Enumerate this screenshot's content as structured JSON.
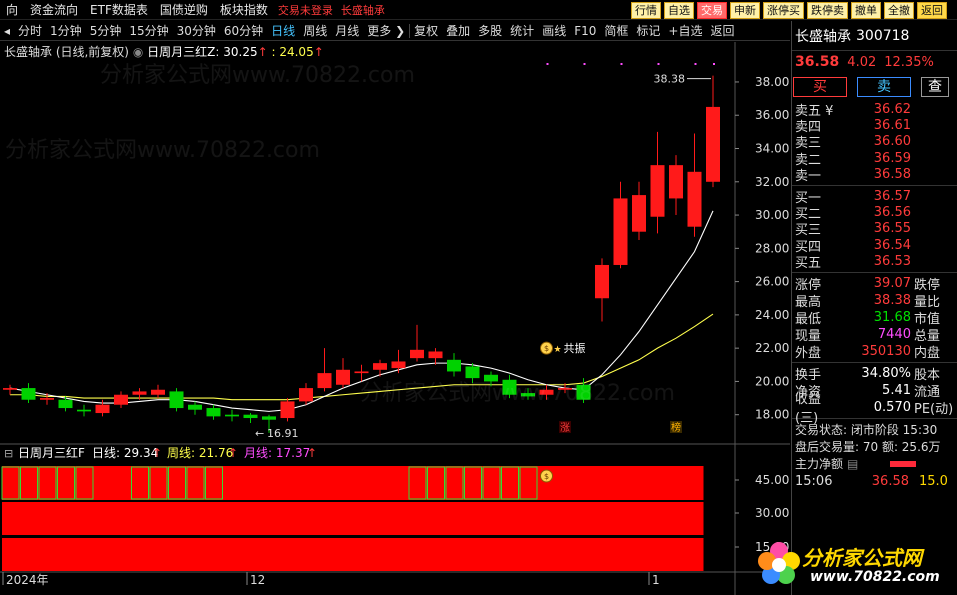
{
  "top_nav": [
    "向",
    "资金流向",
    "ETF数据表",
    "国债逆购",
    "板块指数"
  ],
  "top_status": "交易未登录",
  "top_stock": "长盛轴承",
  "top_buttons": [
    "行情",
    "自选",
    "交易",
    "申新",
    "涨停买",
    "跌停卖",
    "撤单",
    "全撤",
    "返回"
  ],
  "periods": [
    "分时",
    "1分钟",
    "5分钟",
    "15分钟",
    "30分钟",
    "60分钟",
    "日线",
    "周线",
    "月线",
    "更多"
  ],
  "active_period": "日线",
  "tools": [
    "复权",
    "叠加",
    "多股",
    "统计",
    "画线",
    "F10",
    "简框",
    "标记",
    "+自选",
    "返回"
  ],
  "chart_header": {
    "title": "长盛轴承 (日线,前复权)",
    "indicator": "日周月三红Z",
    "value1": "30.25",
    "value2": "24.05"
  },
  "sub_header": {
    "indicator": "日周月三红F",
    "day": "日线: 29.34",
    "week": "周线: 21.76",
    "month": "月线: 17.37"
  },
  "annotations": {
    "high_label": "38.38",
    "low_label": "16.91",
    "resonance_label": "共振",
    "zhang_badge": "涨",
    "bang_badge": "榜"
  },
  "x_axis_labels": [
    "2024年",
    "12",
    "1"
  ],
  "quote": {
    "name": "长盛轴承",
    "code": "300718",
    "price": "36.58",
    "change": "4.02",
    "pct": "12.35%",
    "buy_label": "买",
    "sell_label": "卖",
    "query_label": "查",
    "asks": [
      {
        "label": "卖五 ¥",
        "price": "36.62"
      },
      {
        "label": "卖四",
        "price": "36.61"
      },
      {
        "label": "卖三",
        "price": "36.60"
      },
      {
        "label": "卖二",
        "price": "36.59"
      },
      {
        "label": "卖一",
        "price": "36.58"
      }
    ],
    "bids": [
      {
        "label": "买一",
        "price": "36.57"
      },
      {
        "label": "买二",
        "price": "36.56"
      },
      {
        "label": "买三",
        "price": "36.55"
      },
      {
        "label": "买四",
        "price": "36.54"
      },
      {
        "label": "买五",
        "price": "36.53"
      }
    ],
    "stats1": [
      {
        "label": "涨停",
        "value": "39.07",
        "label2": "跌停",
        "color": "red"
      },
      {
        "label": "最高",
        "value": "38.38",
        "label2": "量比",
        "color": "red"
      },
      {
        "label": "最低",
        "value": "31.68",
        "label2": "市值",
        "color": "green"
      },
      {
        "label": "现量",
        "value": "7440",
        "label2": "总量",
        "color": "magenta"
      },
      {
        "label": "外盘",
        "value": "350130",
        "label2": "内盘",
        "color": "red"
      }
    ],
    "stats2": [
      {
        "label": "换手",
        "value": "34.80%",
        "label2": "股本",
        "color": "white"
      },
      {
        "label": "净资",
        "value": "5.41",
        "label2": "流通",
        "color": "white"
      },
      {
        "label": "收益(三)",
        "value": "0.570",
        "label2": "PE(动)",
        "color": "white"
      }
    ],
    "trade_status": "交易状态: 闭市阶段 15:30",
    "after_hours": "盘后交易量: 70  额: 25.6万",
    "main_flow_label": "主力净额",
    "ticks": [
      {
        "time": "15:06",
        "price": "36.58",
        "vol": "15.0"
      }
    ]
  },
  "logo": {
    "brand": "分析家公式网",
    "url": "www.70822.com"
  },
  "watermark": "分析家公式网www.70822.com",
  "chart_data": {
    "type": "candlestick",
    "title": "长盛轴承 (日线,前复权)",
    "y_ticks": [
      18.0,
      20.0,
      22.0,
      24.0,
      26.0,
      28.0,
      30.0,
      32.0,
      34.0,
      36.0,
      38.0
    ],
    "ylim": [
      16.6,
      39.2
    ],
    "candles": [
      {
        "o": 19.5,
        "c": 19.6,
        "h": 19.8,
        "l": 19.2
      },
      {
        "o": 19.6,
        "c": 18.9,
        "h": 19.9,
        "l": 18.7
      },
      {
        "o": 18.9,
        "c": 19.0,
        "h": 19.3,
        "l": 18.6
      },
      {
        "o": 18.9,
        "c": 18.4,
        "h": 19.1,
        "l": 18.2
      },
      {
        "o": 18.3,
        "c": 18.2,
        "h": 18.6,
        "l": 17.9
      },
      {
        "o": 18.1,
        "c": 18.6,
        "h": 18.9,
        "l": 17.9
      },
      {
        "o": 18.6,
        "c": 19.2,
        "h": 19.4,
        "l": 18.4
      },
      {
        "o": 19.2,
        "c": 19.4,
        "h": 19.6,
        "l": 18.9
      },
      {
        "o": 19.2,
        "c": 19.5,
        "h": 19.8,
        "l": 19.0
      },
      {
        "o": 19.4,
        "c": 18.4,
        "h": 19.6,
        "l": 18.2
      },
      {
        "o": 18.6,
        "c": 18.3,
        "h": 18.8,
        "l": 18.0
      },
      {
        "o": 18.4,
        "c": 17.9,
        "h": 18.6,
        "l": 17.7
      },
      {
        "o": 18.0,
        "c": 17.9,
        "h": 18.3,
        "l": 17.6
      },
      {
        "o": 18.0,
        "c": 17.8,
        "h": 18.1,
        "l": 17.5
      },
      {
        "o": 17.9,
        "c": 17.7,
        "h": 18.0,
        "l": 16.91
      },
      {
        "o": 17.8,
        "c": 18.8,
        "h": 19.0,
        "l": 17.6
      },
      {
        "o": 18.8,
        "c": 19.6,
        "h": 19.9,
        "l": 18.6
      },
      {
        "o": 19.6,
        "c": 20.5,
        "h": 22.0,
        "l": 19.4
      },
      {
        "o": 19.8,
        "c": 20.7,
        "h": 21.4,
        "l": 19.6
      },
      {
        "o": 20.5,
        "c": 20.6,
        "h": 21.0,
        "l": 20.0
      },
      {
        "o": 20.7,
        "c": 21.1,
        "h": 21.3,
        "l": 20.3
      },
      {
        "o": 20.8,
        "c": 21.2,
        "h": 21.9,
        "l": 20.5
      },
      {
        "o": 21.4,
        "c": 21.9,
        "h": 23.4,
        "l": 21.2
      },
      {
        "o": 21.4,
        "c": 21.8,
        "h": 22.0,
        "l": 21.0
      },
      {
        "o": 21.3,
        "c": 20.6,
        "h": 21.7,
        "l": 20.3
      },
      {
        "o": 20.9,
        "c": 20.2,
        "h": 21.1,
        "l": 19.9
      },
      {
        "o": 20.4,
        "c": 20.0,
        "h": 20.6,
        "l": 19.7
      },
      {
        "o": 20.1,
        "c": 19.2,
        "h": 20.4,
        "l": 19.0
      },
      {
        "o": 19.3,
        "c": 19.1,
        "h": 19.6,
        "l": 18.9
      },
      {
        "o": 19.2,
        "c": 19.5,
        "h": 19.8,
        "l": 18.9
      },
      {
        "o": 19.5,
        "c": 19.6,
        "h": 19.9,
        "l": 19.3
      },
      {
        "o": 19.8,
        "c": 18.9,
        "h": 20.2,
        "l": 18.7
      },
      {
        "o": 25.0,
        "c": 27.0,
        "h": 27.4,
        "l": 23.6
      },
      {
        "o": 27.0,
        "c": 31.0,
        "h": 32.0,
        "l": 26.8
      },
      {
        "o": 29.0,
        "c": 31.2,
        "h": 32.0,
        "l": 28.5
      },
      {
        "o": 29.9,
        "c": 33.0,
        "h": 35.0,
        "l": 28.9
      },
      {
        "o": 31.0,
        "c": 33.0,
        "h": 33.6,
        "l": 30.0
      },
      {
        "o": 29.3,
        "c": 32.6,
        "h": 34.9,
        "l": 28.7
      },
      {
        "o": 32.0,
        "c": 36.5,
        "h": 38.38,
        "l": 31.68
      }
    ],
    "ma_fast": [
      19.6,
      19.4,
      19.2,
      19.0,
      18.8,
      18.7,
      18.7,
      18.8,
      18.9,
      18.9,
      18.8,
      18.6,
      18.4,
      18.3,
      18.2,
      18.3,
      18.6,
      19.1,
      19.6,
      20.0,
      20.4,
      20.7,
      21.0,
      21.1,
      21.1,
      21.0,
      20.8,
      20.5,
      20.1,
      19.8,
      19.6,
      19.5,
      20.4,
      21.6,
      23.0,
      24.6,
      26.2,
      27.8,
      30.25
    ],
    "ma_slow": [
      19.2,
      19.2,
      19.1,
      19.1,
      19.0,
      19.0,
      19.0,
      19.0,
      19.0,
      19.0,
      19.0,
      19.0,
      18.9,
      18.9,
      18.9,
      18.9,
      19.0,
      19.1,
      19.2,
      19.3,
      19.4,
      19.5,
      19.6,
      19.7,
      19.8,
      19.8,
      19.8,
      19.8,
      19.8,
      19.8,
      19.8,
      19.9,
      20.3,
      20.8,
      21.3,
      22.0,
      22.6,
      23.3,
      24.05
    ],
    "sub_panel": {
      "y_ticks": [
        15.0,
        30.0,
        45.0
      ],
      "green_boxes_row1": [
        [
          0,
          4
        ],
        [
          7,
          11
        ],
        [
          22,
          28
        ]
      ],
      "signal_index": 29
    }
  }
}
